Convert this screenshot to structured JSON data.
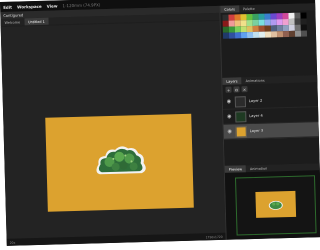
{
  "menubar": {
    "items": [
      "Edit",
      "Workspace",
      "View"
    ],
    "status_text": "1-120mm (74.9PX)",
    "min_icon": "minimize-icon",
    "max_icon": "maximize-icon",
    "close_icon": "close-icon"
  },
  "canvas": {
    "panel_title": "Contigured",
    "tabs": [
      "Welcome",
      "Untitled 1"
    ],
    "active_tab": 1,
    "artboard_color": "#dca22f",
    "status_left": "20x",
    "status_right": "1796x1720"
  },
  "colors_panel": {
    "tabs": [
      "Colors",
      "Palette"
    ],
    "swatches": [
      "#2d2d2d",
      "#d04040",
      "#e07a2a",
      "#e0c030",
      "#64c040",
      "#3aa060",
      "#2aa0a0",
      "#3a7fd0",
      "#6a4ad0",
      "#a040c0",
      "#d04a9a",
      "#f0f0f0",
      "#5a5a5a",
      "#000000",
      "#8a1a1a",
      "#f09a9a",
      "#f0c07a",
      "#f0e08a",
      "#a0e08a",
      "#7ad0a0",
      "#7ae0e0",
      "#8ab0f0",
      "#b09af0",
      "#e09af0",
      "#f0a0d0",
      "#c0c0c0",
      "#404040",
      "#202020",
      "#2a6a2a",
      "#3a9a3a",
      "#7ad05a",
      "#c0e070",
      "#e0c060",
      "#d08040",
      "#a05030",
      "#704020",
      "#506080",
      "#7080a0",
      "#90a0c0",
      "#d0d0e0",
      "#707070",
      "#101010",
      "#203a6a",
      "#3050a0",
      "#4070d0",
      "#60a0f0",
      "#90c0f0",
      "#c0e0f0",
      "#e0f0f0",
      "#f0e0c0",
      "#e0c0a0",
      "#c09070",
      "#906050",
      "#604030",
      "#909090",
      "#505050"
    ]
  },
  "layers_panel": {
    "tabs": [
      "Layers",
      "Animations"
    ],
    "layers": [
      {
        "name": "Layer 2",
        "selected": false
      },
      {
        "name": "Layer 4",
        "selected": false
      },
      {
        "name": "Layer 3",
        "selected": true
      }
    ]
  },
  "preview_panel": {
    "tabs": [
      "Preview",
      "Animation"
    ]
  }
}
